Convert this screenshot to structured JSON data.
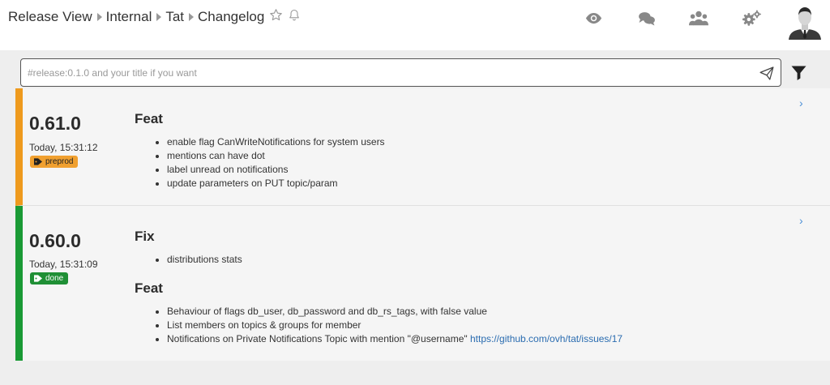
{
  "breadcrumb": [
    "Release View",
    "Internal",
    "Tat",
    "Changelog"
  ],
  "header_icons": [
    "eye-icon",
    "comments-icon",
    "users-icon",
    "gears-icon",
    "star-icon",
    "bell-icon"
  ],
  "search": {
    "placeholder": "#release:0.1.0 and your title if you want"
  },
  "releases": [
    {
      "version": "0.61.0",
      "date": "Today, 15:31:12",
      "tag": "preprod",
      "tag_color": "#ee9a1d",
      "sections": [
        {
          "title": "Feat",
          "items": [
            "enable flag CanWriteNotifications for system users",
            "mentions can have dot",
            "label unread on notifications",
            "update parameters on PUT topic/param"
          ]
        }
      ]
    },
    {
      "version": "0.60.0",
      "date": "Today, 15:31:09",
      "tag": "done",
      "tag_color": "#1a9a35",
      "sections": [
        {
          "title": "Fix",
          "items": [
            "distributions stats"
          ]
        },
        {
          "title": "Feat",
          "items": [
            "Behaviour of flags db_user, db_password and db_rs_tags, with false value",
            "List members on topics & groups for member",
            "Notifications on Private Notifications Topic with mention \"@username\""
          ],
          "link": "https://github.com/ovh/tat/issues/17"
        }
      ]
    }
  ]
}
